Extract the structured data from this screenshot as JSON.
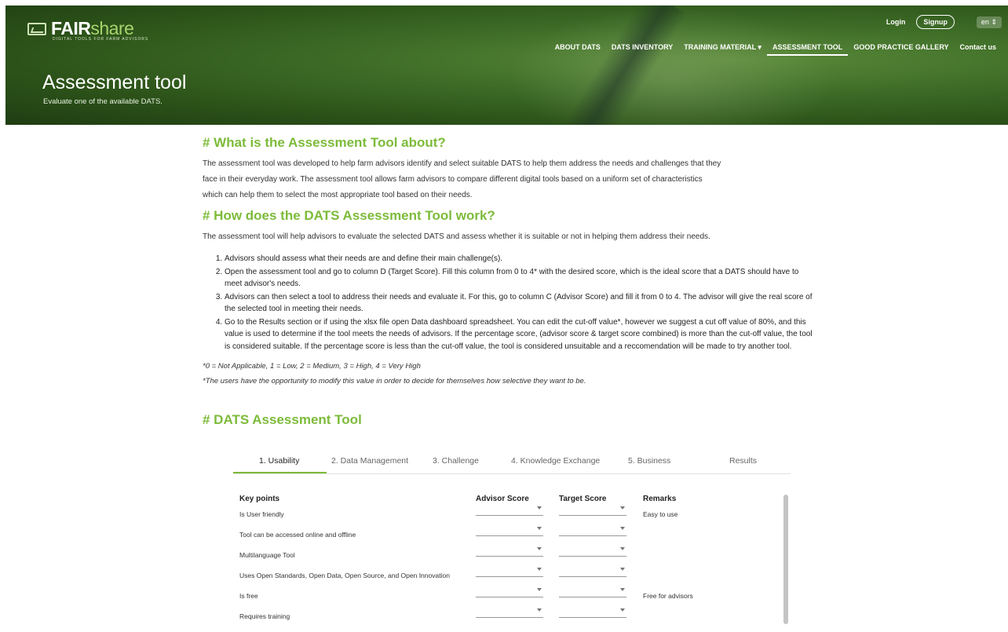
{
  "brand": {
    "name_main": "FAIR",
    "name_accent": "share",
    "tagline": "DIGITAL TOOLS FOR FARM ADVISORS"
  },
  "topbar": {
    "login": "Login",
    "signup": "Signup",
    "language": "en"
  },
  "nav": [
    {
      "label": "ABOUT DATS"
    },
    {
      "label": "DATS INVENTORY"
    },
    {
      "label": "TRAINING MATERIAL ▾"
    },
    {
      "label": "ASSESSMENT TOOL"
    },
    {
      "label": "GOOD PRACTICE GALLERY"
    },
    {
      "label": "Contact us"
    }
  ],
  "hero": {
    "title": "Assessment tool",
    "subtitle": "Evaluate one of the available DATS."
  },
  "section1": {
    "heading": "# What is the Assessment Tool about?",
    "line1": "The assessment tool was developed to help farm advisors identify and select suitable DATS to help them address the needs and challenges that they",
    "line2": "face in their everyday work. The assessment tool allows farm advisors to compare different digital tools based on a uniform set of characteristics",
    "line3": "which can help them to select the most appropriate tool based on their needs."
  },
  "section2": {
    "heading": "# How does the DATS Assessment Tool work?",
    "intro": "The assessment tool will help advisors to evaluate the selected DATS and assess whether it is suitable or not in helping them address their needs.",
    "steps": [
      "Advisors should assess what their needs are and define their main challenge(s).",
      "Open the assessment tool and go to column D (Target Score). Fill this column from 0 to 4* with the desired score, which is the ideal score that a DATS should have to meet advisor's needs.",
      "Advisors can then select a tool to address their needs and evaluate it. For this, go to column C (Advisor Score) and fill it from 0 to 4. The advisor will give the real score of the selected tool in meeting their needs.",
      "Go to the Results section or if using the xlsx file open Data dashboard spreadsheet. You can edit the cut-off value*, however we suggest a cut off value of 80%, and this value is used to determine if the tool meets the needs of advisors. If the percentage score, (advisor score & target score combined) is more than the cut-off value, the tool is considered suitable. If the percentage score is less than the cut-off value, the tool is considered unsuitable and a reccomendation will be made to try another tool."
    ],
    "note1": "*0 = Not Applicable, 1 = Low, 2 = Medium, 3 = High, 4 = Very High",
    "note2": "*The users have the opportunity to modify this value in order to decide for themselves how selective they want to be."
  },
  "tool": {
    "heading": "# DATS Assessment Tool",
    "tabs": [
      "1. Usability",
      "2. Data Management",
      "3. Challenge",
      "4. Knowledge Exchange",
      "5. Business",
      "Results"
    ],
    "headers": {
      "key_points": "Key points",
      "advisor": "Advisor Score",
      "target": "Target Score",
      "remarks": "Remarks"
    },
    "rows": [
      {
        "label": "Is User friendly",
        "remark": "Easy to use"
      },
      {
        "label": "Tool can be accessed online and offline",
        "remark": ""
      },
      {
        "label": "Multilanguage Tool",
        "remark": ""
      },
      {
        "label": "Uses Open Standards, Open Data, Open Source, and Open Innovation",
        "remark": ""
      },
      {
        "label": "Is free",
        "remark": "Free for advisors"
      },
      {
        "label": "Requires training",
        "remark": ""
      }
    ]
  }
}
